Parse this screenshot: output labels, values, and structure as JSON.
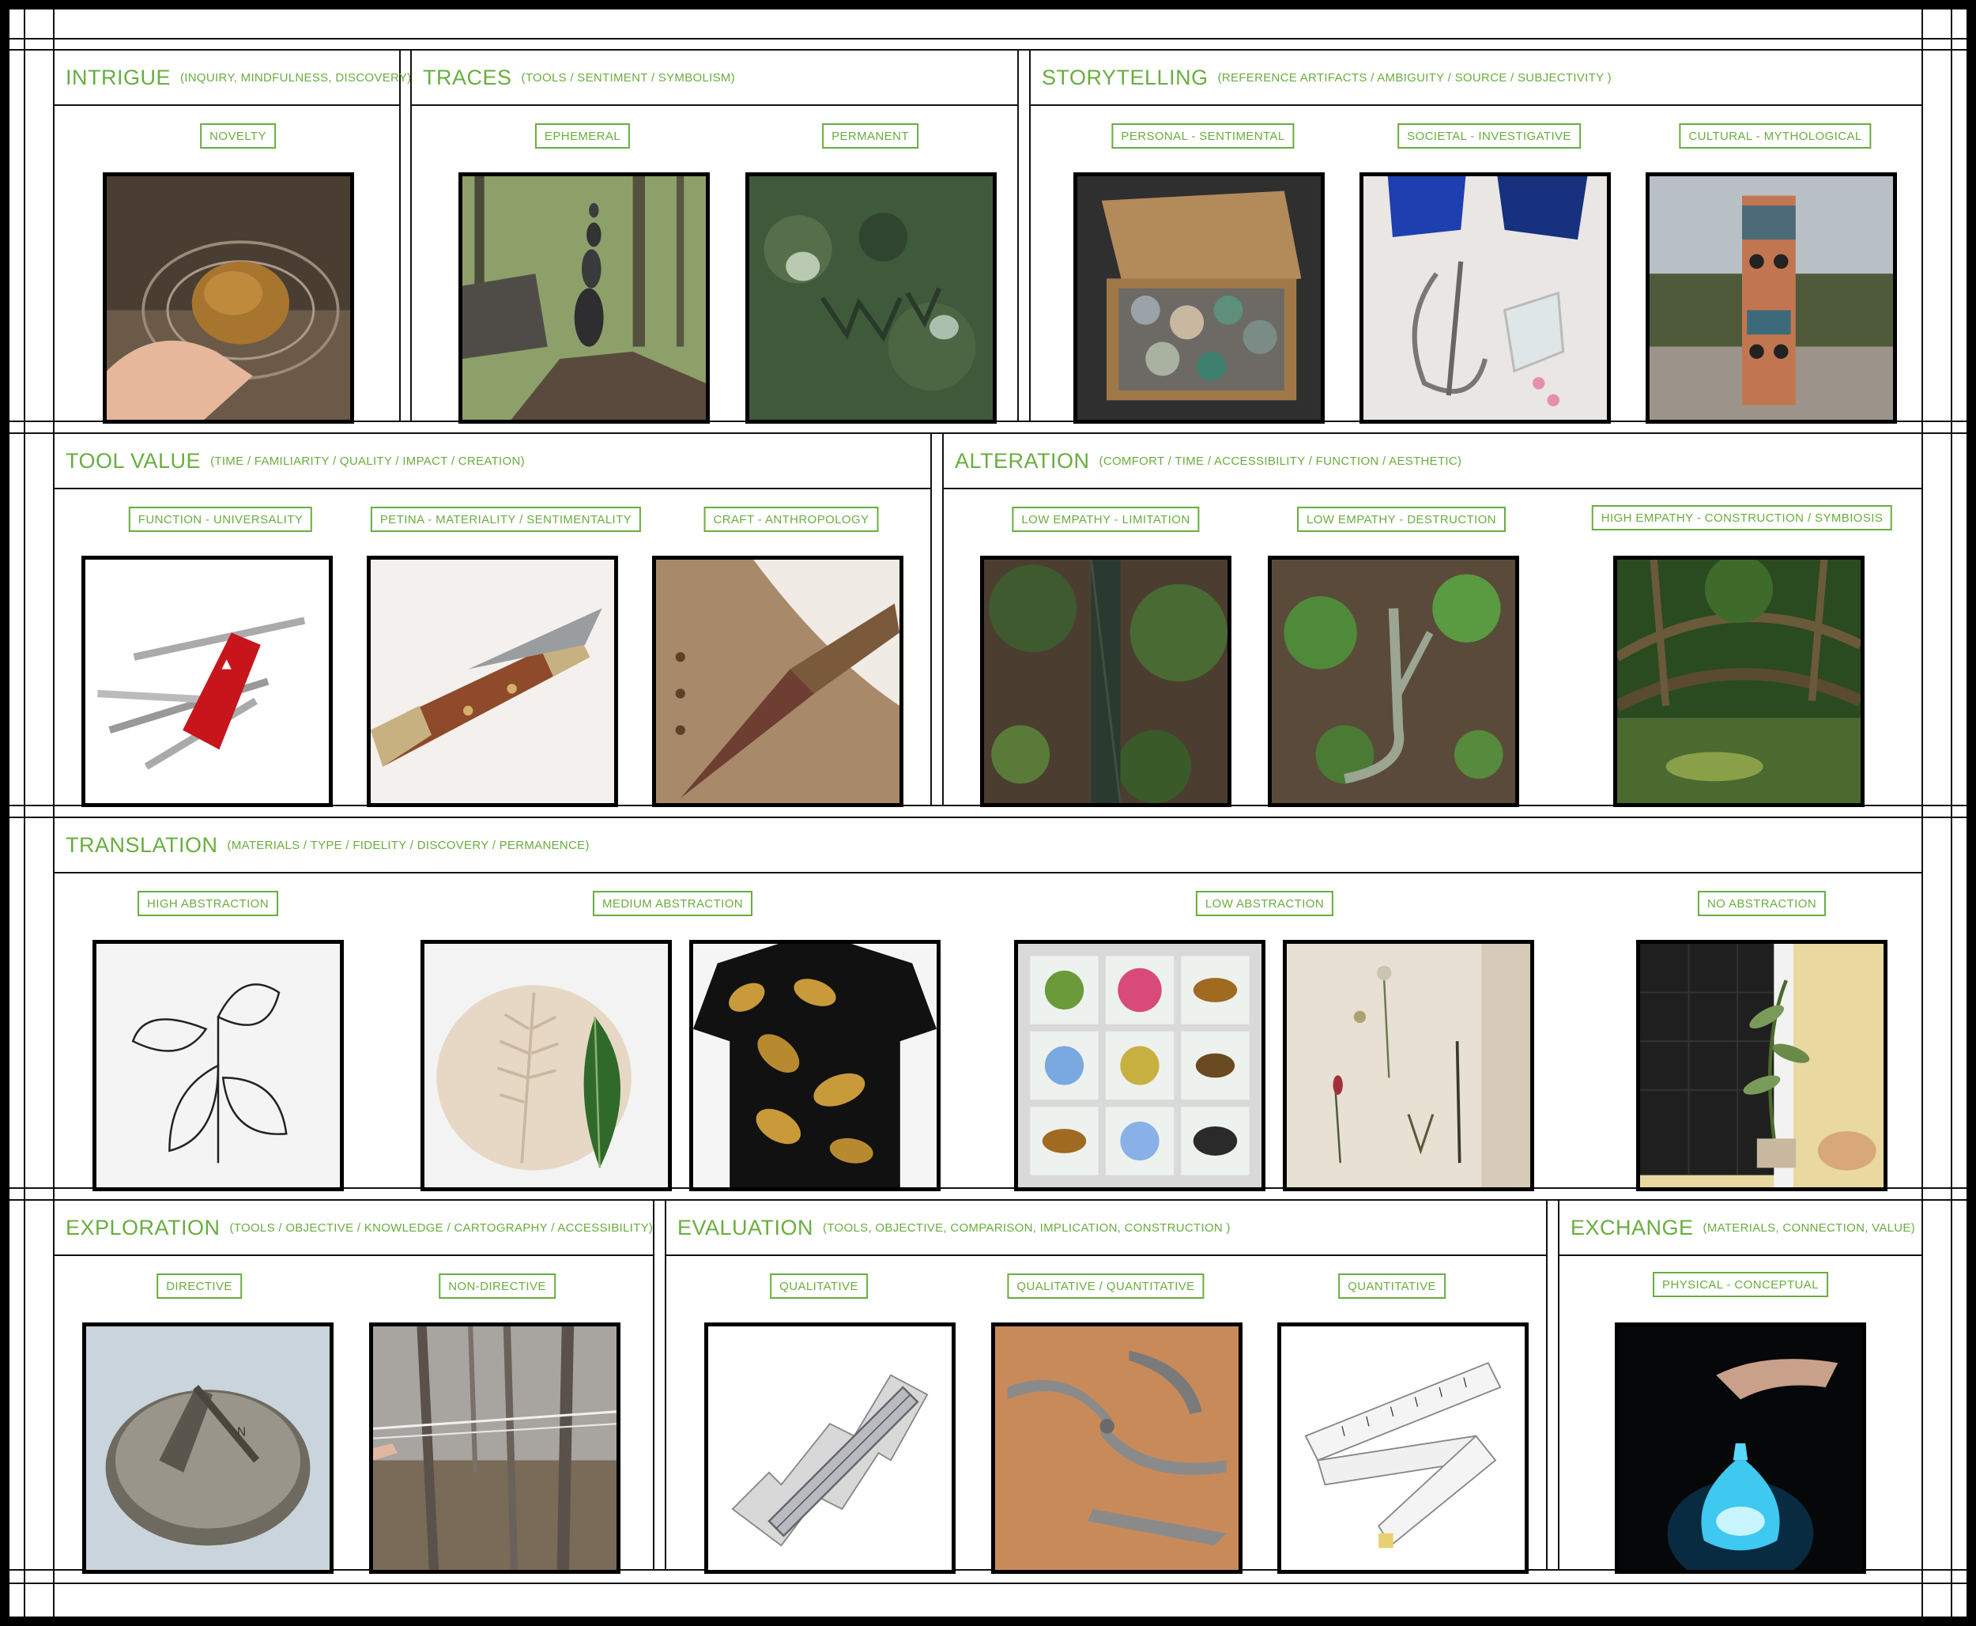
{
  "sections": {
    "intrigue": {
      "title": "INTRIGUE",
      "subtitle": "(INQUIRY, MINDFULNESS, DISCOVERY)",
      "labels": [
        "NOVELTY"
      ],
      "images": [
        "rock-in-hand-water-image"
      ]
    },
    "traces": {
      "title": "TRACES",
      "subtitle": "(TOOLS / SENTIMENT / SYMBOLISM)",
      "labels": [
        "EPHEMERAL",
        "PERMANENT"
      ],
      "images": [
        "stacked-cairn-forest-image",
        "carved-mossy-rock-image"
      ]
    },
    "storytelling": {
      "title": "STORYTELLING",
      "subtitle": "(REFERENCE ARTIFACTS / AMBIGUITY / SOURCE / SUBJECTIVITY )",
      "labels": [
        "PERSONAL - SENTIMENTAL",
        "SOCIETAL - INVESTIGATIVE",
        "CULTURAL - MYTHOLOGICAL"
      ],
      "images": [
        "box-of-stones-image",
        "blue-glass-and-wire-image",
        "totem-pole-image"
      ]
    },
    "tool_value": {
      "title": "TOOL VALUE",
      "subtitle": "(TIME / FAMILIARITY / QUALITY / IMPACT / CREATION)",
      "labels": [
        "FUNCTION - UNIVERSALITY",
        "PETINA - MATERIALITY / SENTIMENTALITY",
        "CRAFT - ANTHROPOLOGY"
      ],
      "images": [
        "swiss-army-knife-image",
        "wooden-pocket-knife-image",
        "stone-blade-knife-image"
      ]
    },
    "alteration": {
      "title": "ALTERATION",
      "subtitle": "(COMFORT / TIME / ACCESSIBILITY / FUNCTION / AESTHETIC)",
      "labels": [
        "LOW EMPATHY - LIMITATION",
        "LOW EMPATHY - DESTRUCTION",
        "HIGH EMPATHY - CONSTRUCTION / SYMBIOSIS"
      ],
      "images": [
        "tree-guard-forest-image",
        "cut-sapling-image",
        "living-root-bridge-image"
      ]
    },
    "translation": {
      "title": "TRANSLATION",
      "subtitle": "(MATERIALS / TYPE / FIDELITY / DISCOVERY / PERMANENCE)",
      "labels": [
        "HIGH ABSTRACTION",
        "MEDIUM ABSTRACTION",
        "LOW ABSTRACTION",
        "NO ABSTRACTION"
      ],
      "images": [
        "leaf-line-drawing-image",
        "leaf-clay-imprint-image",
        "leaf-print-shirt-image",
        "resin-specimens-image",
        "pressed-herbarium-image",
        "potted-plant-window-image"
      ]
    },
    "exploration": {
      "title": "EXPLORATION",
      "subtitle": "(TOOLS / OBJECTIVE / KNOWLEDGE / CARTOGRAPHY / ACCESSIBILITY)",
      "labels": [
        "DIRECTIVE",
        "NON-DIRECTIVE"
      ],
      "images": [
        "sundial-compass-image",
        "string-line-forest-image"
      ]
    },
    "evaluation": {
      "title": "EVALUATION",
      "subtitle": "(TOOLS, OBJECTIVE, COMPARISON, IMPLICATION, CONSTRUCTION )",
      "labels": [
        "QUALITATIVE",
        "QUALITATIVE / QUANTITATIVE",
        "QUANTITATIVE"
      ],
      "images": [
        "contour-gauge-image",
        "calipers-image",
        "measuring-tape-image"
      ]
    },
    "exchange": {
      "title": "EXCHANGE",
      "subtitle": "(MATERIALS, CONNECTION, VALUE)",
      "labels": [
        "PHYSICAL - CONCEPTUAL"
      ],
      "images": [
        "glowing-glass-drop-image"
      ]
    }
  },
  "colors": {
    "accent": "#69ad3f",
    "frame": "#111111",
    "background": "#ffffff"
  }
}
